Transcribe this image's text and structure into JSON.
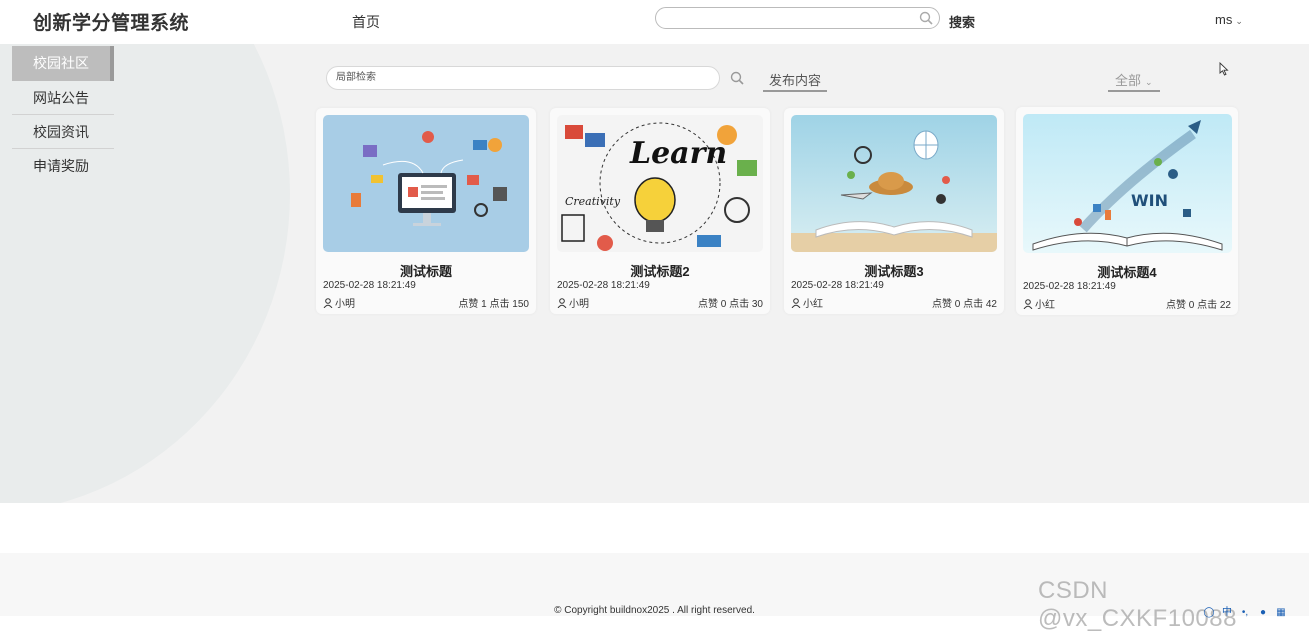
{
  "header": {
    "app_title": "创新学分管理系统",
    "nav_home": "首页",
    "search_placeholder": "",
    "search_button": "搜索",
    "user_name": "ms"
  },
  "sidebar": {
    "items": [
      {
        "label": "校园社区",
        "active": true
      },
      {
        "label": "网站公告",
        "active": false
      },
      {
        "label": "校园资讯",
        "active": false
      },
      {
        "label": "申请奖励",
        "active": false
      }
    ]
  },
  "toolbar": {
    "local_search_placeholder": "局部检索",
    "publish_label": "发布内容",
    "filter_label": "全部"
  },
  "posts": [
    {
      "title": "测试标题",
      "date": "2025-02-28 18:21:49",
      "author": "小明",
      "stats": "点赞 1 点击 150",
      "image": "digital-marketing-illustration"
    },
    {
      "title": "测试标题2",
      "date": "2025-02-28 18:21:49",
      "author": "小明",
      "stats": "点赞 0 点击 30",
      "image": "learn-lightbulb-illustration"
    },
    {
      "title": "测试标题3",
      "date": "2025-02-28 18:21:49",
      "author": "小红",
      "stats": "点赞 0 点击 42",
      "image": "open-book-travel-illustration"
    },
    {
      "title": "测试标题4",
      "date": "2025-02-28 18:21:49",
      "author": "小红",
      "stats": "点赞 0 点击 22",
      "image": "book-rocket-win-illustration"
    }
  ],
  "footer": {
    "copyright": "© Copyright buildnox2025 . All right reserved.",
    "watermark": "CSDN @vx_CXKF10088",
    "tray_ime": "中"
  },
  "colors": {
    "sidebar_active_bg": "#bdbdbd",
    "page_bg": "#f2f2f2"
  }
}
